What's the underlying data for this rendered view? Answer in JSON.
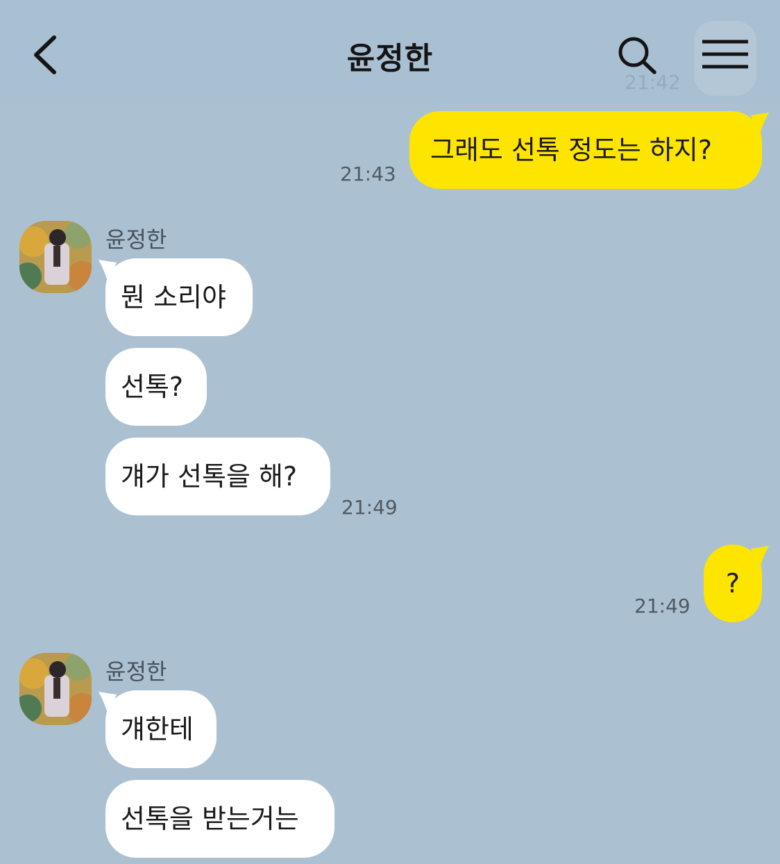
{
  "header": {
    "title": "윤정한"
  },
  "ghost_time": "21:42",
  "messages": {
    "m1": {
      "text": "그래도 선톡 정도는 하지?",
      "time": "21:43"
    },
    "sender1": "윤정한",
    "m2": {
      "text": "뭔 소리야"
    },
    "m3": {
      "text": "선톡?"
    },
    "m4": {
      "text": "걔가 선톡을 해?",
      "time": "21:49"
    },
    "m5": {
      "text": "?",
      "time": "21:49"
    },
    "sender2": "윤정한",
    "m6": {
      "text": "걔한테"
    },
    "m7": {
      "text": "선톡을 받는거는"
    }
  },
  "colors": {
    "background": "#abc1d1",
    "my_bubble": "#fee500",
    "their_bubble": "#ffffff"
  },
  "icons": [
    "back-chevron-icon",
    "search-icon",
    "menu-icon"
  ]
}
